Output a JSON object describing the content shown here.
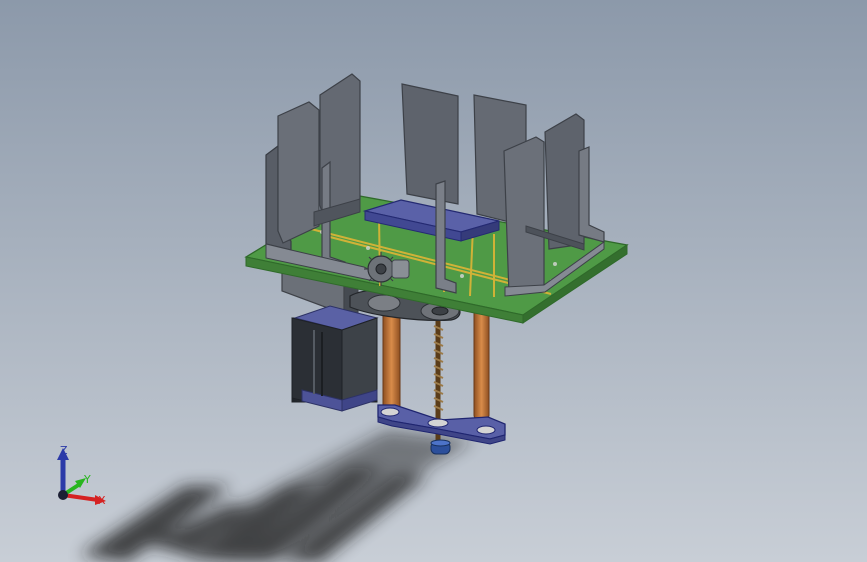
{
  "viewport": {
    "background_top": "#8c99aa",
    "background_bottom": "#c8ced6"
  },
  "model": {
    "parts": {
      "base_plate_color": "#4f9a46",
      "trace_color": "#d7b437",
      "bracket_color": "#62676f",
      "motor_body_color": "#2f3339",
      "motor_cap_color": "#53599d",
      "lead_screw_color": "#7f5a2f",
      "rod_color": "#c3763d",
      "carriage_color": "#5b61a8",
      "pulley_color": "#6f7277",
      "belt_color": "#3f4349",
      "knob_color": "#2c4f9b"
    }
  },
  "triad": {
    "x_label": "X",
    "y_label": "Y",
    "z_label": "Z",
    "x_color": "#d52222",
    "y_color": "#28b51f",
    "z_color": "#2b3aa8",
    "origin_color": "#1b1f33"
  }
}
